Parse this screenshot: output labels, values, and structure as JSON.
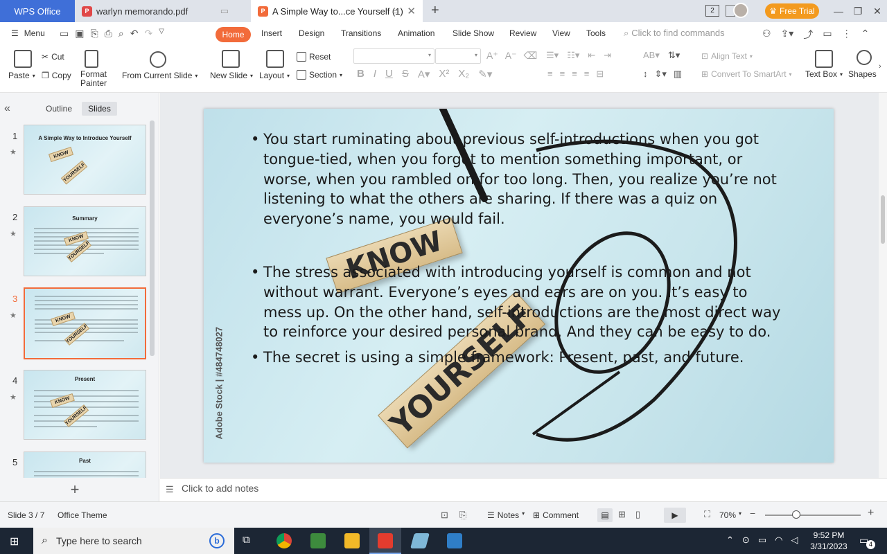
{
  "tabs": {
    "wps": "WPS Office",
    "pdf": "warlyn memorando.pdf",
    "ppt": "A Simple Way to...ce Yourself (1)"
  },
  "titlebar": {
    "badge": "2",
    "free_trial": "Free Trial"
  },
  "menu": {
    "menu_label": "Menu",
    "items": [
      "Home",
      "Insert",
      "Design",
      "Transitions",
      "Animation",
      "Slide Show",
      "Review",
      "View",
      "Tools"
    ],
    "search_placeholder": "Click to find commands"
  },
  "ribbon": {
    "paste": "Paste",
    "cut": "Cut",
    "copy": "Copy",
    "format_painter": "Format\nPainter",
    "from_current": "From Current Slide",
    "new_slide": "New Slide",
    "layout": "Layout",
    "reset": "Reset",
    "section": "Section",
    "align_text": "Align Text",
    "convert_smartart": "Convert To SmartArt",
    "text_box": "Text Box",
    "shapes": "Shapes"
  },
  "leftpanel": {
    "outline_tab": "Outline",
    "slides_tab": "Slides",
    "thumbs": [
      {
        "num": "1",
        "title": "A Simple Way to Introduce Yourself"
      },
      {
        "num": "2",
        "title": "Summary"
      },
      {
        "num": "3",
        "title": ""
      },
      {
        "num": "4",
        "title": "Present"
      },
      {
        "num": "5",
        "title": "Past"
      }
    ]
  },
  "slide": {
    "bullet1": "You start ruminating about previous self-introductions when you got tongue-tied, when you forgot to mention something important, or worse, when you rambled on for too long. Then, you realize you’re not listening to what the others are sharing. If there was a quiz on everyone’s name, you would fail.",
    "bullet2": "The stress associated with introducing yourself is common and not without warrant. Everyone’s eyes and ears are on you. It’s easy to mess up. On the other hand, self-introductions are the most direct way to reinforce your desired personal brand. And they can be easy to do.",
    "bullet3": "The secret is using a simple framework: Present, past, and future.",
    "block1": "KNOW",
    "block2": "YOURSELF",
    "watermark": "Adobe Stock | #484748027"
  },
  "notes": {
    "placeholder": "Click to add notes"
  },
  "status": {
    "slide_counter": "Slide 3 / 7",
    "theme": "Office Theme",
    "notes_btn": "Notes",
    "comment_btn": "Comment",
    "zoom": "70%"
  },
  "taskbar": {
    "search_placeholder": "Type here to search",
    "time": "9:52 PM",
    "date": "3/31/2023",
    "notif_count": "4"
  }
}
